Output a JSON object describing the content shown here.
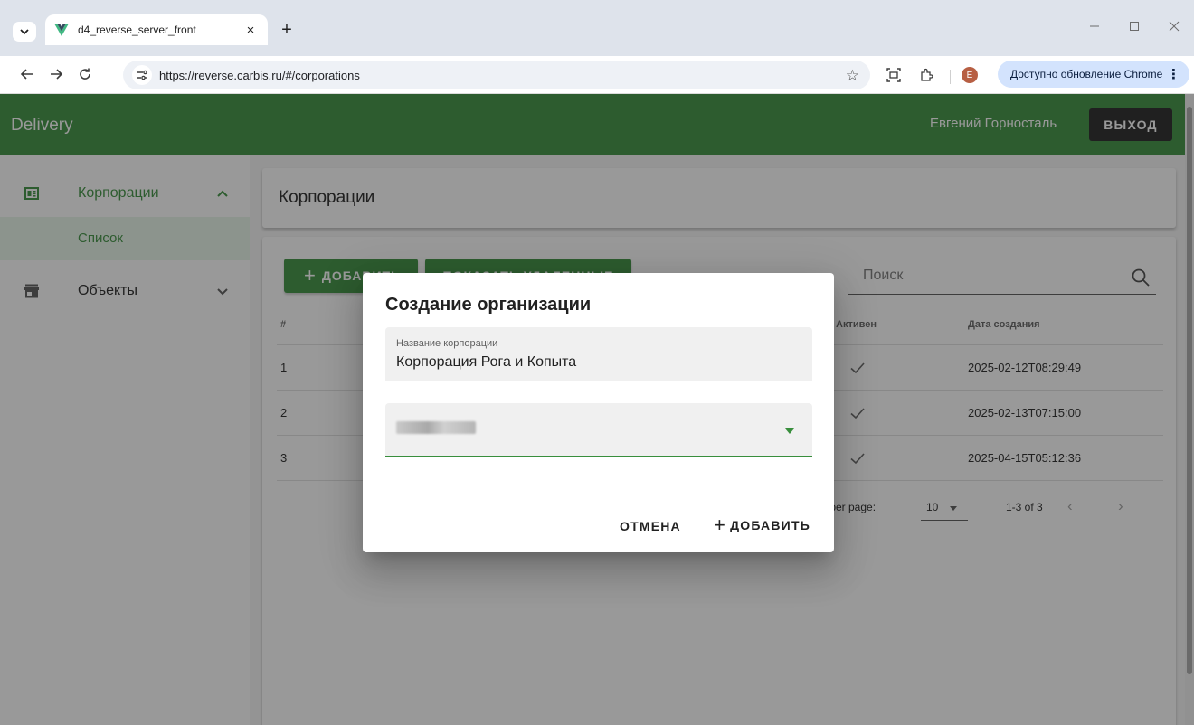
{
  "browser": {
    "tab_title": "d4_reverse_server_front",
    "url": "https://reverse.carbis.ru/#/corporations",
    "profile_initial": "E",
    "update_label": "Доступно обновление Chrome",
    "tab_close": "×",
    "new_tab": "+",
    "icons": [
      "tab-search-icon",
      "vue-favicon-icon",
      "back-icon",
      "forward-icon",
      "reload-icon",
      "site-info-icon",
      "star-icon",
      "screenshot-icon",
      "extensions-icon",
      "more-icon"
    ]
  },
  "app": {
    "title": "Delivery",
    "user_name": "Евгений Горносталь",
    "logout_label": "ВЫХОД",
    "brand_color": "#388e3c"
  },
  "sidebar": {
    "items": [
      {
        "label": "Корпорации",
        "icon": "corporations-icon",
        "expanded": true
      },
      {
        "label": "Список",
        "icon": "",
        "active": true
      },
      {
        "label": "Объекты",
        "icon": "store-icon",
        "expanded": false
      }
    ]
  },
  "page": {
    "title": "Корпорации",
    "add_label": "ДОБАВИТЬ",
    "show_deleted_label": "ПОКАЗАТЬ УДАЛЕННЫЕ",
    "search_placeholder": "Поиск"
  },
  "table": {
    "headers": {
      "num": "#",
      "active": "Активен",
      "created": "Дата создания"
    },
    "rows": [
      {
        "num": "1",
        "active": true,
        "created": "2025-02-12T08:29:49"
      },
      {
        "num": "2",
        "active": true,
        "created": "2025-02-13T07:15:00"
      },
      {
        "num": "3",
        "active": true,
        "created": "2025-04-15T05:12:36"
      }
    ],
    "rows_per_page_label": "s per page:",
    "rows_per_page": "10",
    "range": "1-3 of 3"
  },
  "dialog": {
    "title": "Создание организации",
    "name_label": "Название корпорации",
    "name_value": "Корпорация Рога и Копыта",
    "cancel_label": "ОТМЕНА",
    "submit_label": "ДОБАВИТЬ"
  }
}
